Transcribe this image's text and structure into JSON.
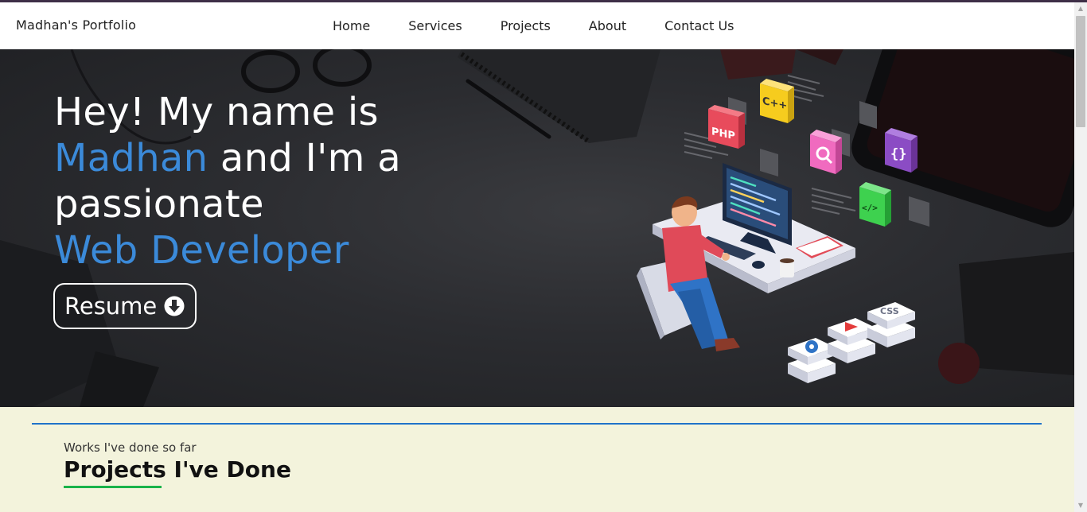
{
  "nav": {
    "brand": "Madhan's Portfolio",
    "links": [
      "Home",
      "Services",
      "Projects",
      "About",
      "Contact Us"
    ]
  },
  "hero": {
    "line1": "Hey! My name is",
    "name": "Madhan",
    "line2_rest": " and I'm a",
    "line3": "passionate",
    "role": "Web Developer",
    "resume_label": "Resume",
    "illustration_badges": [
      "PHP",
      "C++",
      "CSS"
    ]
  },
  "projects_section": {
    "subtitle": "Works I've done so far",
    "title": "Projects I've Done"
  },
  "colors": {
    "accent_blue": "#3b8ad9",
    "divider_blue": "#1f73c9",
    "underline_green": "#19b34a",
    "section_bg": "#f3f3dc"
  }
}
